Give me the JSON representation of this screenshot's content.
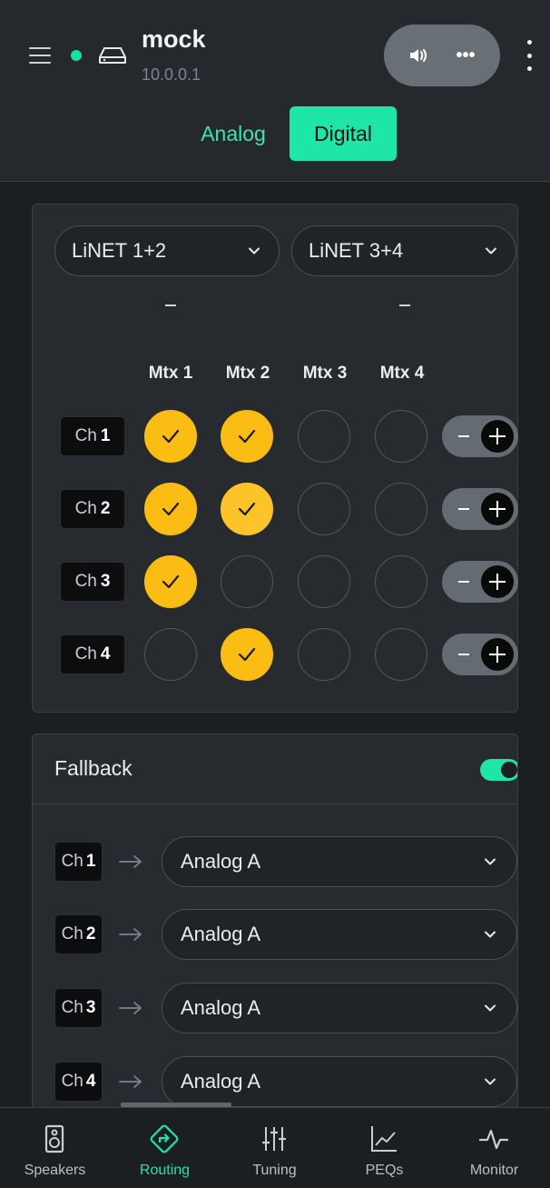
{
  "header": {
    "device_name": "mock",
    "device_ip": "10.0.0.1",
    "pill_more": "•••"
  },
  "tabs": [
    {
      "label": "Analog",
      "selected": false
    },
    {
      "label": "Digital",
      "selected": true
    }
  ],
  "matrix": {
    "inputs": [
      "LiNET 1+2",
      "LiNET 3+4"
    ],
    "input_values": [
      "-",
      "-"
    ],
    "columns": [
      "Mtx 1",
      "Mtx 2",
      "Mtx 3",
      "Mtx 4"
    ],
    "rows": [
      {
        "prefix": "Ch",
        "num": "1",
        "on": [
          true,
          true,
          false,
          false
        ]
      },
      {
        "prefix": "Ch",
        "num": "2",
        "on": [
          true,
          true,
          false,
          false
        ]
      },
      {
        "prefix": "Ch",
        "num": "3",
        "on": [
          true,
          false,
          false,
          false
        ]
      },
      {
        "prefix": "Ch",
        "num": "4",
        "on": [
          false,
          true,
          false,
          false
        ]
      }
    ]
  },
  "fallback": {
    "title": "Fallback",
    "enabled": true,
    "rows": [
      {
        "prefix": "Ch",
        "num": "1",
        "source": "Analog A"
      },
      {
        "prefix": "Ch",
        "num": "2",
        "source": "Analog A"
      },
      {
        "prefix": "Ch",
        "num": "3",
        "source": "Analog A"
      },
      {
        "prefix": "Ch",
        "num": "4",
        "source": "Analog A"
      }
    ]
  },
  "nav": [
    {
      "label": "Speakers",
      "icon": "speaker-icon",
      "active": false
    },
    {
      "label": "Routing",
      "icon": "routing-icon",
      "active": true
    },
    {
      "label": "Tuning",
      "icon": "sliders-icon",
      "active": false
    },
    {
      "label": "PEQs",
      "icon": "graph-icon",
      "active": false
    },
    {
      "label": "Monitor",
      "icon": "pulse-icon",
      "active": false
    }
  ],
  "colors": {
    "accent": "#1de6a6",
    "active_cell": "#fbbc13",
    "background": "#1c1f22"
  }
}
